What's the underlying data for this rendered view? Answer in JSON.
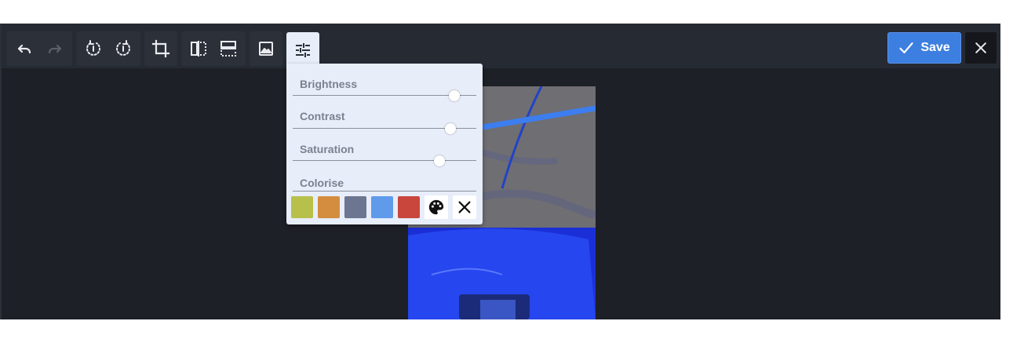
{
  "toolbar": {
    "icons": {
      "undo": "undo-icon",
      "redo": "redo-icon",
      "rotate_left": "rotate-left-icon",
      "rotate_right": "rotate-right-icon",
      "crop": "crop-icon",
      "flip_horizontal": "flip-horizontal-icon",
      "flip_vertical": "flip-vertical-icon",
      "image": "image-icon",
      "adjust": "sliders-icon"
    },
    "save_label": "Save",
    "accent_color": "#3d7fe0"
  },
  "adjust_panel": {
    "brightness": {
      "label": "Brightness",
      "value": 0.88
    },
    "contrast": {
      "label": "Contrast",
      "value": 0.86
    },
    "saturation": {
      "label": "Saturation",
      "value": 0.8
    },
    "colorise": {
      "label": "Colorise",
      "swatches": [
        "#b6c04a",
        "#d48c3e",
        "#6c7690",
        "#5f9bea",
        "#c8463c"
      ]
    }
  }
}
